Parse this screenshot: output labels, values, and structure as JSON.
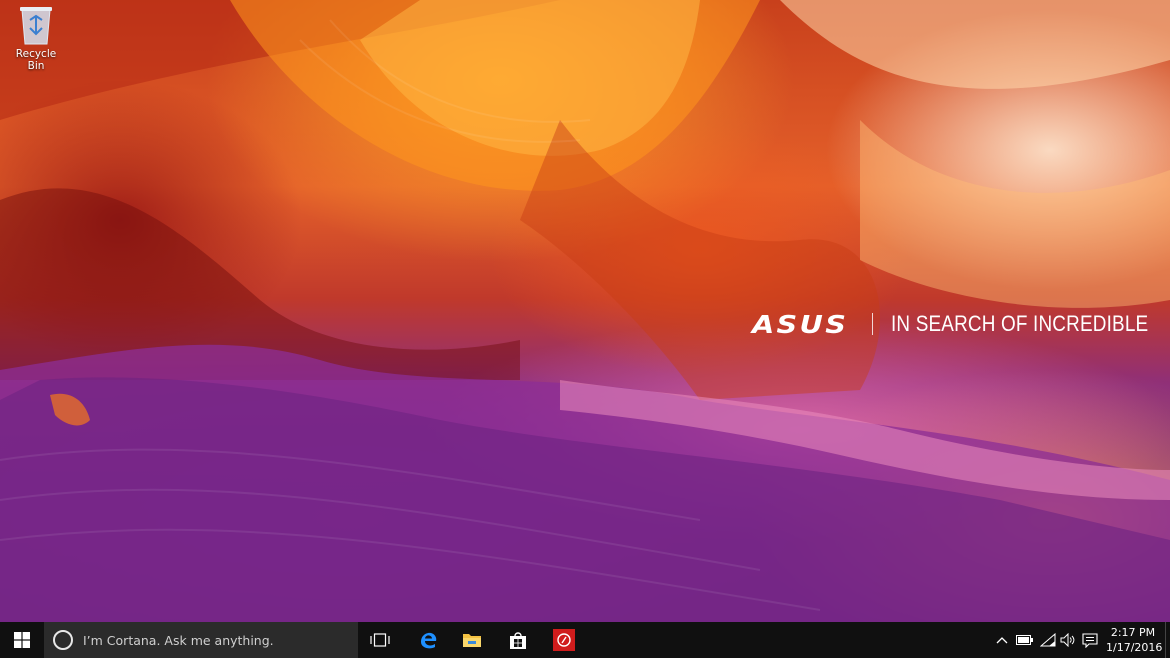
{
  "desktop": {
    "icons": [
      {
        "label": "Recycle Bin",
        "icon": "recycle-bin-icon"
      }
    ],
    "wallpaper": {
      "brand_logo": "ASUS",
      "tagline": "IN SEARCH OF INCREDIBLE"
    }
  },
  "taskbar": {
    "start": {
      "icon": "windows-logo-icon"
    },
    "search": {
      "placeholder": "I’m Cortana. Ask me anything.",
      "icon": "cortana-icon"
    },
    "task_view": {
      "icon": "task-view-icon"
    },
    "pinned_apps": [
      {
        "name": "Microsoft Edge",
        "icon": "edge-icon",
        "color": "#1e90ff"
      },
      {
        "name": "File Explorer",
        "icon": "folder-icon",
        "color": "#f4c242"
      },
      {
        "name": "Store",
        "icon": "store-icon",
        "color": "#ffffff"
      },
      {
        "name": "ASUS app",
        "icon": "asus-app-icon",
        "color": "#d01c1c"
      }
    ],
    "tray": {
      "icons": [
        "chevron-up-icon",
        "battery-icon",
        "wifi-icon",
        "volume-icon",
        "action-center-icon"
      ],
      "time": "2:17 PM",
      "date": "1/17/2016"
    }
  },
  "colors": {
    "taskbar": "#101010",
    "search_box": "#2b2b2b",
    "accent_edge": "#1e90ff",
    "accent_asus_app": "#d01c1c"
  }
}
